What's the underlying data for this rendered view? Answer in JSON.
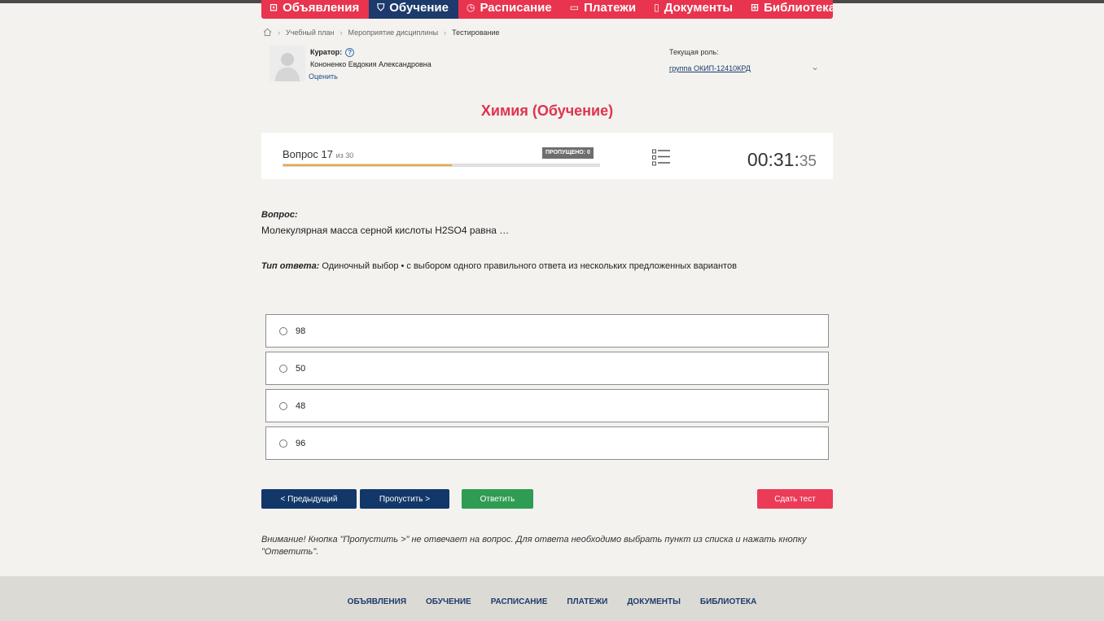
{
  "nav": {
    "items": [
      {
        "label": "Объявления",
        "icon": "megaphone-icon",
        "glyph": "⊡",
        "active": false
      },
      {
        "label": "Обучение",
        "icon": "graduation-icon",
        "glyph": "⛉",
        "active": true
      },
      {
        "label": "Расписание",
        "icon": "clock-icon",
        "glyph": "◷",
        "active": false
      },
      {
        "label": "Платежи",
        "icon": "wallet-icon",
        "glyph": "▭",
        "active": false
      },
      {
        "label": "Документы",
        "icon": "document-icon",
        "glyph": "▯",
        "active": false
      },
      {
        "label": "Библиотека",
        "icon": "library-icon",
        "glyph": "⊞",
        "active": false,
        "chevron": "⌄"
      }
    ]
  },
  "breadcrumb": {
    "items": [
      "Учебный план",
      "Мероприятие дисциплины",
      "Тестирование"
    ]
  },
  "curator": {
    "label": "Куратор:",
    "name": "Кононенко Евдокия Александровна",
    "rate_link": "Оценить"
  },
  "role": {
    "label": "Текущая роль:",
    "value": "группа ОКИП-12410КРД"
  },
  "page_title": "Химия (Обучение)",
  "status": {
    "question_label": "Вопрос 17",
    "question_of": "из 30",
    "skipped_badge": "ПРОПУЩЕНО: 0",
    "progress_fraction": 0.533,
    "timer_main": "00:31:",
    "timer_seconds": "35"
  },
  "question": {
    "heading": "Вопрос:",
    "text": "Молекулярная масса серной кислоты H2SO4 равна …"
  },
  "answer_type": {
    "label": "Тип ответа:",
    "value": " Одиночный выбор • с выбором одного правильного ответа из нескольких предложенных вариантов"
  },
  "options": [
    "98",
    "50",
    "48",
    "96"
  ],
  "buttons": {
    "prev": "< Предыдущий",
    "skip": "Пропустить >",
    "answer": "Ответить",
    "submit": "Сдать тест"
  },
  "warning": "Внимание! Кнопка \"Пропустить >\" не отвечает на вопрос. Для ответа необходимо выбрать пункт из списка и нажать кнопку \"Ответить\".",
  "footer": {
    "links": [
      "ОБЪЯВЛЕНИЯ",
      "ОБУЧЕНИЕ",
      "РАСПИСАНИЕ",
      "ПЛАТЕЖИ",
      "ДОКУМЕНТЫ",
      "БИБЛИОТЕКА"
    ]
  },
  "colors": {
    "accent_red": "#e8344e",
    "nav_active": "#1c3a6b",
    "progress": "#f0a93a",
    "answer_green": "#2e9c52"
  }
}
